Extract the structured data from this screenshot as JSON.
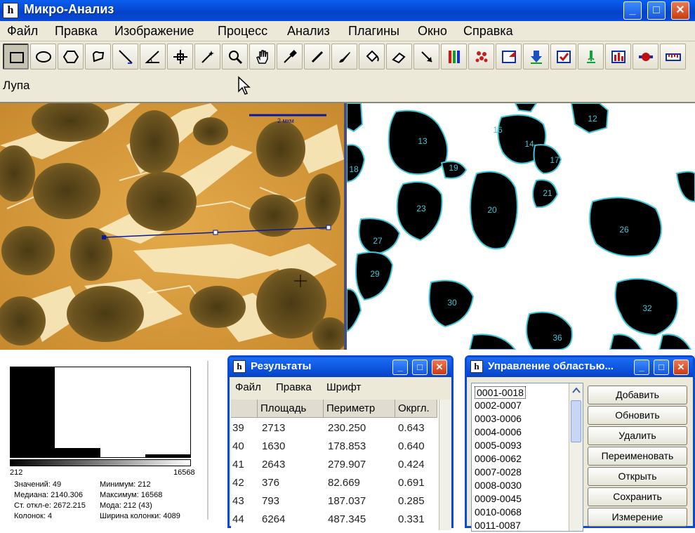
{
  "app": {
    "title": "Микро-Анализ",
    "icon_letter": "h"
  },
  "menu": [
    "Файл",
    "Правка",
    "Изображение",
    "Процесс",
    "Анализ",
    "Плагины",
    "Окно",
    "Справка"
  ],
  "toolbar": {
    "selected_tool": "rectangle-tool",
    "tools": [
      "rectangle-tool",
      "oval-tool",
      "polygon-tool",
      "freehand-tool",
      "line-tool",
      "angle-tool",
      "point-tool",
      "wand-tool",
      "magnifier-tool",
      "hand-tool",
      "dropper-tool",
      "pencil-tool",
      "brush-tool",
      "fill-tool",
      "eraser-tool",
      "arrow-tool",
      "rgb-tool",
      "particles-tool",
      "crop-tool",
      "download-tool",
      "checklist-tool",
      "microscope-tool",
      "bar-chart-tool",
      "blob-tool",
      "ruler-tool"
    ]
  },
  "status": {
    "tool_label": "Лупа"
  },
  "image": {
    "scale_label": "2 мкм",
    "particle_labels": [
      "12",
      "13",
      "14",
      "16",
      "17",
      "18",
      "19",
      "20",
      "21",
      "23",
      "26",
      "27",
      "29",
      "30",
      "32",
      "36"
    ]
  },
  "histogram": {
    "min_label": "212",
    "max_label": "16568",
    "stats": [
      "Значений: 49",
      "Минимум: 212",
      "Медиана: 2140.306",
      "Максимум: 16568",
      "Ст. откл-е: 2672.215",
      "Мода: 212 (43)",
      "Колонок: 4",
      "Ширина колонки: 4089"
    ]
  },
  "results": {
    "title": "Результаты",
    "menu": [
      "Файл",
      "Правка",
      "Шрифт"
    ],
    "columns": [
      "",
      "Площадь",
      "Периметр",
      "Окргл."
    ],
    "rows": [
      [
        "39",
        "2713",
        "230.250",
        "0.643"
      ],
      [
        "40",
        "1630",
        "178.853",
        "0.640"
      ],
      [
        "41",
        "2643",
        "279.907",
        "0.424"
      ],
      [
        "42",
        "376",
        "82.669",
        "0.691"
      ],
      [
        "43",
        "793",
        "187.037",
        "0.285"
      ],
      [
        "44",
        "6264",
        "487.345",
        "0.331"
      ]
    ]
  },
  "roi": {
    "title": "Управление областью...",
    "items": [
      "0001-0018",
      "0002-0007",
      "0003-0006",
      "0004-0006",
      "0005-0093",
      "0006-0062",
      "0007-0028",
      "0008-0030",
      "0009-0045",
      "0010-0068",
      "0011-0087"
    ],
    "buttons": [
      "Добавить",
      "Обновить",
      "Удалить",
      "Переименовать",
      "Открыть",
      "Сохранить",
      "Измерение"
    ]
  },
  "colors": {
    "titlebar": "#0442c8",
    "highlight": "#316ac5",
    "particle_outline": "#40c8d8"
  }
}
